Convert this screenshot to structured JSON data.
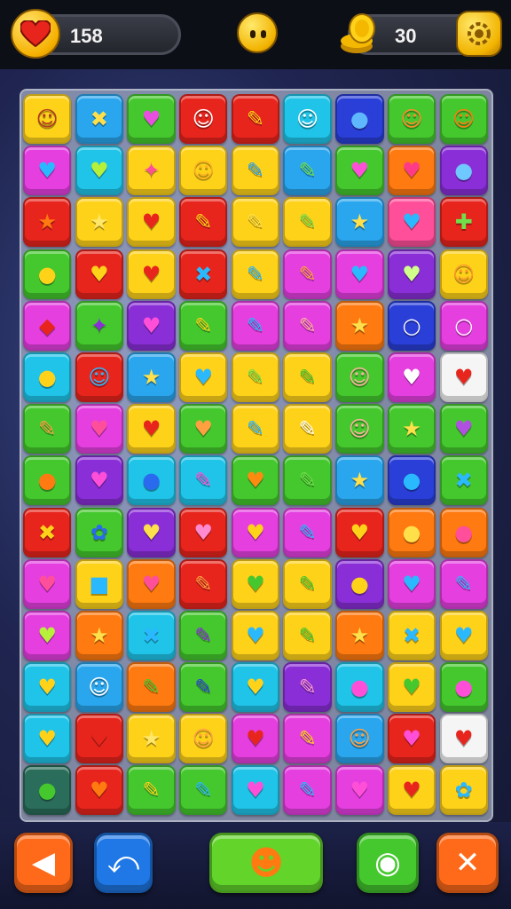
{
  "hud": {
    "lives_value": "158",
    "coins_value": "30",
    "lives_icon": "heart-icon",
    "face_icon": "smiley-face-icon",
    "coins_icon": "coin-stack-icon",
    "settings_icon": "gear-icon"
  },
  "colors": {
    "yellow": "#ffd21a",
    "blue": "#2aa6ee",
    "green": "#45c82e",
    "red": "#e8251d",
    "orange": "#ff7a10",
    "magenta": "#e53fe0",
    "purple": "#8a2fd8",
    "cyan": "#1fc4e8",
    "pink": "#ff4f9a",
    "darkblue": "#2a3fd8",
    "teal": "#2a6d5a",
    "white": "#f5f5f5",
    "lime": "#9fe026"
  },
  "board": {
    "rows": [
      [
        [
          "yellow",
          "☺",
          "#b03a1f"
        ],
        [
          "blue",
          "✖",
          "#ffe04a"
        ],
        [
          "green",
          "♥",
          "#e84fe0"
        ],
        [
          "red",
          "☺",
          "#ffffff"
        ],
        [
          "red",
          "✎",
          "#ffd21a"
        ],
        [
          "cyan",
          "☺",
          "#ffffff"
        ],
        [
          "darkblue",
          "●",
          "#5fb8ff"
        ],
        [
          "green",
          "☺",
          "#ff8a2a"
        ],
        [
          "green",
          "☺",
          "#ff7a10"
        ]
      ],
      [
        [
          "magenta",
          "♥",
          "#2ab8ff"
        ],
        [
          "cyan",
          "♥",
          "#b7f03a"
        ],
        [
          "yellow",
          "✦",
          "#ff4f9a"
        ],
        [
          "yellow",
          "☺",
          "#ffb020"
        ],
        [
          "yellow",
          "✎",
          "#2aa6ee"
        ],
        [
          "blue",
          "✎",
          "#6fe04a"
        ],
        [
          "green",
          "♥",
          "#ff4fd8"
        ],
        [
          "orange",
          "♥",
          "#ff3a8a"
        ],
        [
          "purple",
          "●",
          "#6fc8ff"
        ],
        [
          "orange",
          "♥",
          "#ff4fd8"
        ]
      ],
      [
        [
          "red",
          "★",
          "#ff7a10"
        ],
        [
          "yellow",
          "★",
          "#ffe76a"
        ],
        [
          "yellow",
          "♥",
          "#e8251d"
        ],
        [
          "red",
          "✎",
          "#ffd21a"
        ],
        [
          "yellow",
          "✎",
          "#ffe04a"
        ],
        [
          "yellow",
          "✎",
          "#6fe04a"
        ],
        [
          "blue",
          "★",
          "#ffe04a"
        ],
        [
          "pink",
          "♥",
          "#2ab8ff"
        ],
        [
          "red",
          "✚",
          "#6fe04a"
        ],
        [
          "orange",
          "♥",
          "#e8251d"
        ]
      ],
      [
        [
          "green",
          "●",
          "#ffd21a"
        ],
        [
          "red",
          "♥",
          "#ffd21a"
        ],
        [
          "yellow",
          "♥",
          "#e8251d"
        ],
        [
          "red",
          "✖",
          "#2ab8ff"
        ],
        [
          "yellow",
          "✎",
          "#2ab8ff"
        ],
        [
          "magenta",
          "✎",
          "#ffa040"
        ],
        [
          "magenta",
          "♥",
          "#2ab8ff"
        ],
        [
          "purple",
          "♥",
          "#d0ff8a"
        ],
        [
          "yellow",
          "☺",
          "#ff9a2a"
        ],
        [
          "blue",
          "☺",
          "#ffffff"
        ]
      ],
      [
        [
          "magenta",
          "◆",
          "#e8251d"
        ],
        [
          "green",
          "✦",
          "#8a2fd8"
        ],
        [
          "purple",
          "♥",
          "#ff4fd8"
        ],
        [
          "green",
          "✎",
          "#ffd21a"
        ],
        [
          "magenta",
          "✎",
          "#2ab8ff"
        ],
        [
          "magenta",
          "✎",
          "#ffb0a0"
        ],
        [
          "orange",
          "★",
          "#ffe04a"
        ],
        [
          "darkblue",
          "○",
          "#ffffff"
        ],
        [
          "magenta",
          "○",
          "#ffffff"
        ],
        [
          "yellow",
          "♥",
          "#ff8a10"
        ]
      ],
      [
        [
          "cyan",
          "●",
          "#ffd21a"
        ],
        [
          "red",
          "☺",
          "#2ab8ff"
        ],
        [
          "blue",
          "★",
          "#ffe04a"
        ],
        [
          "yellow",
          "♥",
          "#2ab8ff"
        ],
        [
          "yellow",
          "✎",
          "#6fe04a"
        ],
        [
          "yellow",
          "✎",
          "#45c82e"
        ],
        [
          "green",
          "☺",
          "#ffb0a0"
        ],
        [
          "magenta",
          "♥",
          "#ffffff"
        ],
        [
          "white",
          "♥",
          "#e8251d"
        ],
        [
          "purple",
          "■",
          "#45c82e"
        ]
      ],
      [
        [
          "green",
          "✎",
          "#ffa040"
        ],
        [
          "magenta",
          "♥",
          "#ff4f9a"
        ],
        [
          "yellow",
          "♥",
          "#e8251d"
        ],
        [
          "green",
          "♥",
          "#ffa040"
        ],
        [
          "yellow",
          "✎",
          "#2ab8ff"
        ],
        [
          "yellow",
          "✎",
          "#ffffff"
        ],
        [
          "green",
          "☺",
          "#ffb0a0"
        ],
        [
          "green",
          "★",
          "#ffe04a"
        ],
        [
          "green",
          "♥",
          "#b050e0"
        ],
        [
          "green",
          "☺",
          "#ffffff"
        ]
      ],
      [
        [
          "green",
          "●",
          "#ff7a10"
        ],
        [
          "purple",
          "♥",
          "#ff4fd8"
        ],
        [
          "cyan",
          "●",
          "#2a6aee"
        ],
        [
          "cyan",
          "✎",
          "#ff4fd8"
        ],
        [
          "green",
          "♥",
          "#ff8a10"
        ],
        [
          "green",
          "✎",
          "#6fe04a"
        ],
        [
          "blue",
          "★",
          "#ffe04a"
        ],
        [
          "darkblue",
          "●",
          "#2ab8ff"
        ],
        [
          "green",
          "✖",
          "#2ab8ff"
        ],
        [
          "green",
          "☺",
          "#ffffff"
        ]
      ],
      [
        [
          "red",
          "✖",
          "#ffd21a"
        ],
        [
          "green",
          "✿",
          "#2a6aee"
        ],
        [
          "purple",
          "♥",
          "#ffe04a"
        ],
        [
          "red",
          "♥",
          "#ff8ad0"
        ],
        [
          "magenta",
          "♥",
          "#ffd21a"
        ],
        [
          "magenta",
          "✎",
          "#2ab8ff"
        ],
        [
          "red",
          "♥",
          "#ffd21a"
        ],
        [
          "orange",
          "●",
          "#ffe04a"
        ],
        [
          "orange",
          "●",
          "#ff4f9a"
        ],
        [
          "red",
          "○",
          "#ffffff"
        ]
      ],
      [
        [
          "magenta",
          "♥",
          "#ff4f9a"
        ],
        [
          "yellow",
          "■",
          "#2ab8ff"
        ],
        [
          "orange",
          "♥",
          "#ff4f9a"
        ],
        [
          "red",
          "✎",
          "#ffa040"
        ],
        [
          "yellow",
          "♥",
          "#45c82e"
        ],
        [
          "yellow",
          "✎",
          "#45c82e"
        ],
        [
          "purple",
          "●",
          "#ffd21a"
        ],
        [
          "magenta",
          "♥",
          "#2ab8ff"
        ],
        [
          "magenta",
          "✎",
          "#2ab8ff"
        ],
        [
          "green",
          "✖",
          "#ff7a10"
        ]
      ],
      [
        [
          "magenta",
          "♥",
          "#b7f03a"
        ],
        [
          "orange",
          "★",
          "#ffe04a"
        ],
        [
          "cyan",
          "✖",
          "#2ab8ff"
        ],
        [
          "green",
          "✎",
          "#8a2fd8"
        ],
        [
          "yellow",
          "♥",
          "#2ab8ff"
        ],
        [
          "yellow",
          "✎",
          "#45c82e"
        ],
        [
          "orange",
          "★",
          "#ffe04a"
        ],
        [
          "yellow",
          "✖",
          "#2ab8ff"
        ],
        [
          "yellow",
          "♥",
          "#2ab8ff"
        ],
        [
          "yellow",
          "☺",
          "#ffffff"
        ]
      ],
      [
        [
          "cyan",
          "♥",
          "#ffd21a"
        ],
        [
          "blue",
          "☺",
          "#ffffff"
        ],
        [
          "orange",
          "✎",
          "#45c82e"
        ],
        [
          "green",
          "✎",
          "#2a3fd8"
        ],
        [
          "cyan",
          "♥",
          "#ffd21a"
        ],
        [
          "purple",
          "✎",
          "#ff9ad0"
        ],
        [
          "cyan",
          "●",
          "#ff4fd8"
        ],
        [
          "yellow",
          "♥",
          "#45c82e"
        ],
        [
          "green",
          "●",
          "#ff4fd8"
        ],
        [
          "yellow",
          "★",
          "#45c82e"
        ]
      ],
      [
        [
          "cyan",
          "♥",
          "#ffd21a"
        ],
        [
          "red",
          "♥",
          "#e8251d"
        ],
        [
          "yellow",
          "★",
          "#ffe76a"
        ],
        [
          "yellow",
          "☺",
          "#ffa040"
        ],
        [
          "magenta",
          "♥",
          "#e8251d"
        ],
        [
          "magenta",
          "✎",
          "#ffd21a"
        ],
        [
          "blue",
          "☺",
          "#ffa040"
        ],
        [
          "red",
          "♥",
          "#ff4fd8"
        ],
        [
          "white",
          "♥",
          "#e8251d"
        ],
        [
          "red",
          "▤",
          "#ffffff"
        ]
      ],
      [
        [
          "teal",
          "●",
          "#45c82e"
        ],
        [
          "red",
          "♥",
          "#ff7a10"
        ],
        [
          "green",
          "✎",
          "#ffd21a"
        ],
        [
          "green",
          "✎",
          "#2ab8ff"
        ],
        [
          "cyan",
          "♥",
          "#ff4fd8"
        ],
        [
          "magenta",
          "✎",
          "#2ab8ff"
        ],
        [
          "magenta",
          "♥",
          "#ff4fd8"
        ],
        [
          "yellow",
          "♥",
          "#e8251d"
        ],
        [
          "yellow",
          "✿",
          "#2ab8ff"
        ],
        [
          "yellow",
          "☺",
          "#ffa040"
        ]
      ]
    ]
  },
  "controls": [
    {
      "name": "back-button",
      "icon": "arrow-left-icon",
      "glyph": "◀",
      "color": "#ff6a1a"
    },
    {
      "name": "undo-button",
      "icon": "undo-icon",
      "glyph": "⤺",
      "color": "#1f78e6"
    },
    {
      "name": "hint-button",
      "icon": "hint-creature-icon",
      "glyph": "☻",
      "color": "#62d42a"
    },
    {
      "name": "shuffle-button",
      "icon": "globe-icon",
      "glyph": "◉",
      "color": "#45c82e"
    },
    {
      "name": "close-button",
      "icon": "close-icon",
      "glyph": "✕",
      "color": "#ff6a1a"
    }
  ]
}
